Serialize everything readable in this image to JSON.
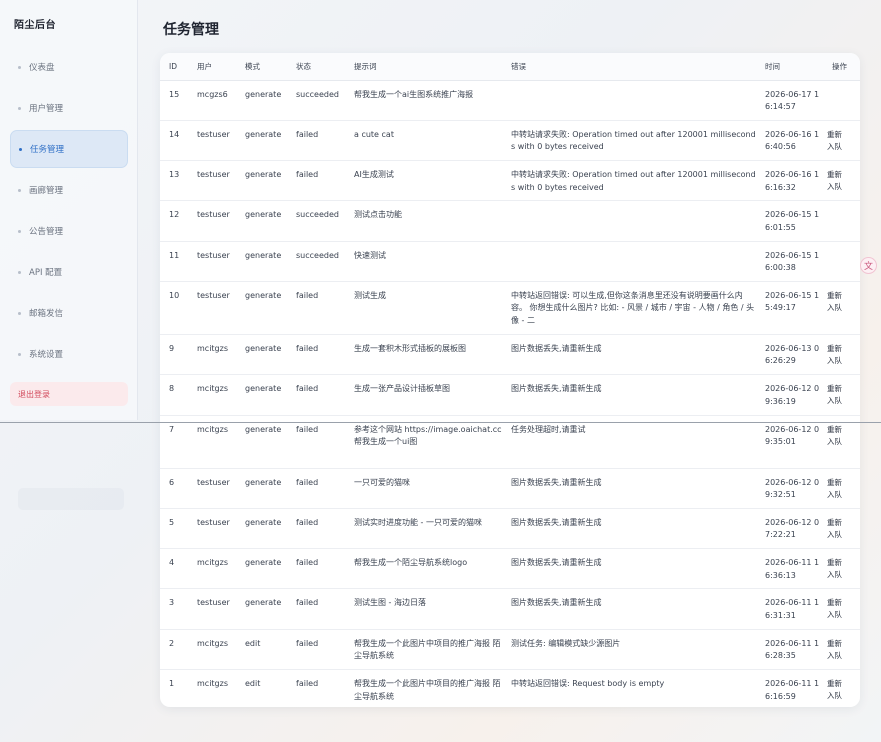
{
  "brand": "陌尘后台",
  "page_title": "任务管理",
  "nav": [
    {
      "label": "仪表盘",
      "name": "sidebar-item-dashboard",
      "active": false
    },
    {
      "label": "用户管理",
      "name": "sidebar-item-users",
      "active": false
    },
    {
      "label": "任务管理",
      "name": "sidebar-item-tasks",
      "active": true
    },
    {
      "label": "画廊管理",
      "name": "sidebar-item-gallery",
      "active": false
    },
    {
      "label": "公告管理",
      "name": "sidebar-item-announcements",
      "active": false
    },
    {
      "label": "API 配置",
      "name": "sidebar-item-api-config",
      "active": false
    },
    {
      "label": "邮箱发信",
      "name": "sidebar-item-email",
      "active": false
    },
    {
      "label": "系统设置",
      "name": "sidebar-item-settings",
      "active": false
    }
  ],
  "logout_label": "退出登录",
  "table": {
    "columns": [
      "ID",
      "用户",
      "模式",
      "状态",
      "提示词",
      "错误",
      "时间",
      "操作"
    ],
    "rows": [
      {
        "id": "15",
        "user": "mcgzs6",
        "mode": "generate",
        "status": "succeeded",
        "prompt": "帮我生成一个ai生图系统推广海报",
        "error": "",
        "time": "2026-06-17 16:14:57",
        "action": ""
      },
      {
        "id": "14",
        "user": "testuser",
        "mode": "generate",
        "status": "failed",
        "prompt": "a cute cat",
        "error": "中转站请求失败: Operation timed out after 120001 milliseconds with 0 bytes received",
        "time": "2026-06-16 16:40:56",
        "action": "重新入队"
      },
      {
        "id": "13",
        "user": "testuser",
        "mode": "generate",
        "status": "failed",
        "prompt": "AI生成测试",
        "error": "中转站请求失败: Operation timed out after 120001 milliseconds with 0 bytes received",
        "time": "2026-06-16 16:16:32",
        "action": "重新入队"
      },
      {
        "id": "12",
        "user": "testuser",
        "mode": "generate",
        "status": "succeeded",
        "prompt": "测试点击功能",
        "error": "",
        "time": "2026-06-15 16:01:55",
        "action": ""
      },
      {
        "id": "11",
        "user": "testuser",
        "mode": "generate",
        "status": "succeeded",
        "prompt": "快速测试",
        "error": "",
        "time": "2026-06-15 16:00:38",
        "action": ""
      },
      {
        "id": "10",
        "user": "testuser",
        "mode": "generate",
        "status": "failed",
        "prompt": "测试生成",
        "error": "中转站返回错误: 可以生成,但你这条消息里还没有说明要画什么内容。 你想生成什么图片? 比如: - 风景 / 城市 / 宇宙 - 人物 / 角色 / 头像 - 二",
        "time": "2026-06-15 15:49:17",
        "action": "重新入队"
      },
      {
        "id": "9",
        "user": "mcitgzs",
        "mode": "generate",
        "status": "failed",
        "prompt": "生成一套积木形式插板的展板图",
        "error": "图片数据丢失,请重新生成",
        "time": "2026-06-13 06:26:29",
        "action": "重新入队"
      },
      {
        "id": "8",
        "user": "mcitgzs",
        "mode": "generate",
        "status": "failed",
        "prompt": "生成一张产品设计插板草图",
        "error": "图片数据丢失,请重新生成",
        "time": "2026-06-12 09:36:19",
        "action": "重新入队"
      },
      {
        "id": "7",
        "user": "mcitgzs",
        "mode": "generate",
        "status": "failed",
        "prompt": "参考这个网站 https://image.oaichat.cc 帮我生成一个ui图",
        "error": "任务处理超时,请重试",
        "time": "2026-06-12 09:35:01",
        "action": "重新入队"
      },
      {
        "id": "6",
        "user": "testuser",
        "mode": "generate",
        "status": "failed",
        "prompt": "一只可爱的猫咪",
        "error": "图片数据丢失,请重新生成",
        "time": "2026-06-12 09:32:51",
        "action": "重新入队"
      },
      {
        "id": "5",
        "user": "testuser",
        "mode": "generate",
        "status": "failed",
        "prompt": "测试实时进度功能 - 一只可爱的猫咪",
        "error": "图片数据丢失,请重新生成",
        "time": "2026-06-12 07:22:21",
        "action": "重新入队"
      },
      {
        "id": "4",
        "user": "mcitgzs",
        "mode": "generate",
        "status": "failed",
        "prompt": "帮我生成一个陌尘导航系统logo",
        "error": "图片数据丢失,请重新生成",
        "time": "2026-06-11 16:36:13",
        "action": "重新入队"
      },
      {
        "id": "3",
        "user": "testuser",
        "mode": "generate",
        "status": "failed",
        "prompt": "测试生图 - 海边日落",
        "error": "图片数据丢失,请重新生成",
        "time": "2026-06-11 16:31:31",
        "action": "重新入队"
      },
      {
        "id": "2",
        "user": "mcitgzs",
        "mode": "edit",
        "status": "failed",
        "prompt": "帮我生成一个此图片中项目的推广海报 陌尘导航系统",
        "error": "测试任务: 编辑模式缺少源图片",
        "time": "2026-06-11 16:28:35",
        "action": "重新入队"
      },
      {
        "id": "1",
        "user": "mcitgzs",
        "mode": "edit",
        "status": "failed",
        "prompt": "帮我生成一个此图片中项目的推广海报 陌尘导航系统",
        "error": "中转站返回错误: Request body is empty",
        "time": "2026-06-11 16:16:59",
        "action": "重新入队"
      }
    ]
  },
  "float_icon": "文"
}
